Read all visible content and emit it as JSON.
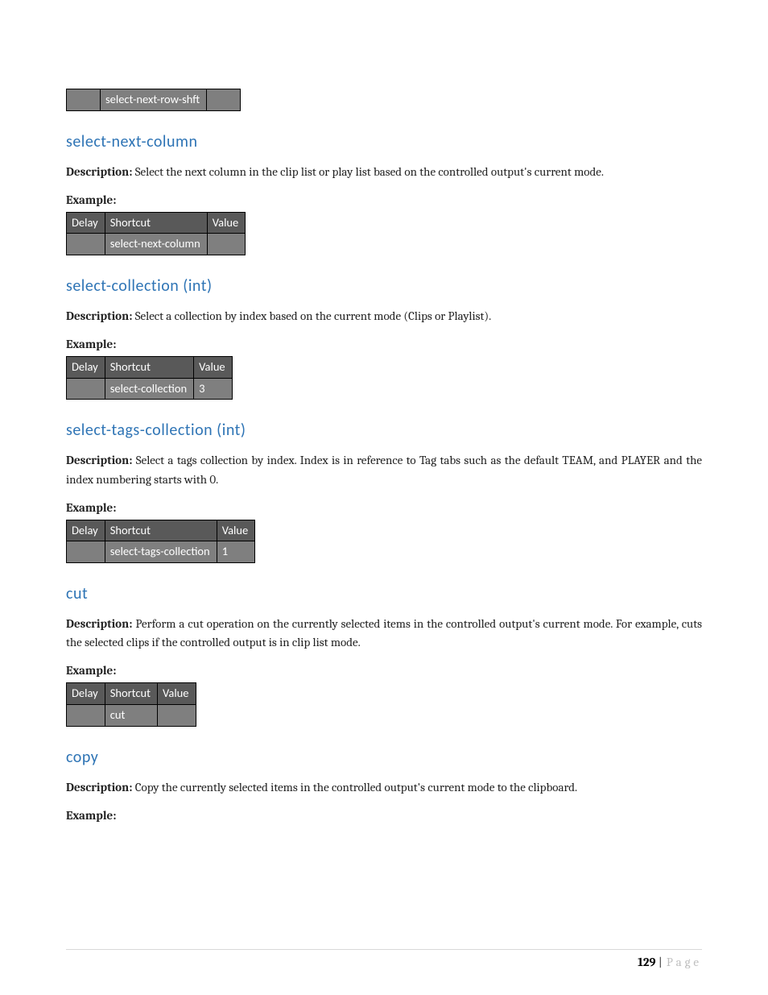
{
  "headers": {
    "delay": "Delay",
    "shortcut": "Shortcut",
    "value": "Value"
  },
  "labels": {
    "description": "Description:",
    "example": "Example:"
  },
  "orphan_table": {
    "shortcut": "select-next-row-shft"
  },
  "sections": [
    {
      "heading": "select-next-column",
      "description": "Select the next column in the clip list or play list based on the controlled output's current mode.",
      "row": {
        "delay": "",
        "shortcut": "select-next-column",
        "value": ""
      }
    },
    {
      "heading": "select-collection (int)",
      "description": "Select a collection by index based on the current mode (Clips or Playlist).",
      "row": {
        "delay": "",
        "shortcut": "select-collection",
        "value": "3"
      }
    },
    {
      "heading": "select-tags-collection (int)",
      "description": "Select a tags collection by index. Index is in reference to Tag tabs such as the default TEAM, and PLAYER and the index numbering starts with 0.",
      "row": {
        "delay": "",
        "shortcut": "select-tags-collection",
        "value": "1"
      }
    },
    {
      "heading": "cut",
      "description": "Perform a cut operation on the currently selected items in the controlled output's current mode.  For example, cuts the selected clips if the controlled output is in clip list mode.",
      "row": {
        "delay": "",
        "shortcut": "cut",
        "value": ""
      }
    },
    {
      "heading": "copy",
      "description": "Copy the currently selected items in the controlled output's current mode to the clipboard.",
      "row": null
    }
  ],
  "footer": {
    "page_number": "129",
    "page_separator": " | ",
    "page_word": "Page"
  }
}
